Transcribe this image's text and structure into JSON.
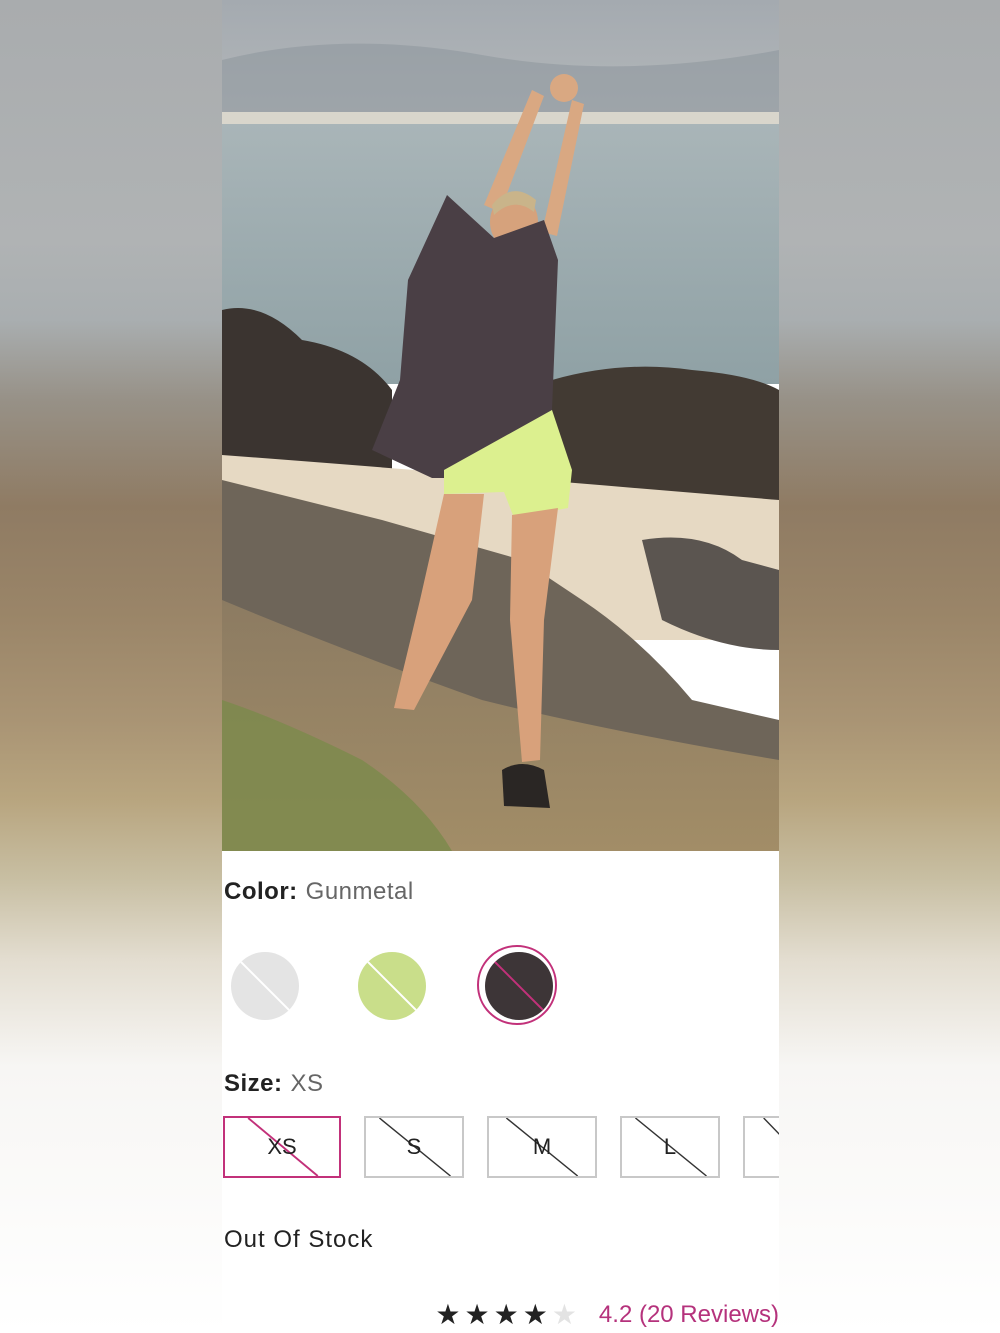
{
  "product": {
    "color_label": "Color:",
    "color_value": "Gunmetal",
    "swatches": [
      {
        "name": "White",
        "hex": "#e4e4e4",
        "selected": false
      },
      {
        "name": "Lime",
        "hex": "#c9de8a",
        "selected": false
      },
      {
        "name": "Gunmetal",
        "hex": "#3d3537",
        "selected": true
      }
    ],
    "size_label": "Size:",
    "size_value": "XS",
    "sizes": [
      {
        "label": "XS",
        "selected": true
      },
      {
        "label": "S",
        "selected": false
      },
      {
        "label": "M",
        "selected": false
      },
      {
        "label": "L",
        "selected": false
      },
      {
        "label": "",
        "selected": false
      }
    ],
    "stock_status": "Out Of Stock",
    "rating": {
      "stars_filled": 4,
      "stars_total": 5,
      "text": "4.2 (20 Reviews)"
    }
  },
  "colors": {
    "accent": "#c2317a",
    "rating_text": "#b5327c",
    "unavailable_border": "#c8c8c8"
  }
}
